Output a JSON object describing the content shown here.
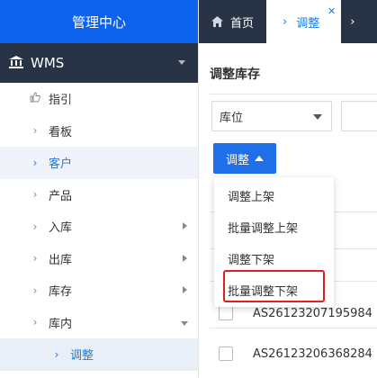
{
  "sidebar": {
    "brand": "管理中心",
    "module": "WMS",
    "items": [
      {
        "label": "指引"
      },
      {
        "label": "看板"
      },
      {
        "label": "客户"
      },
      {
        "label": "产品"
      },
      {
        "label": "入库"
      },
      {
        "label": "出库"
      },
      {
        "label": "库存"
      },
      {
        "label": "库内"
      },
      {
        "label": "调整"
      }
    ],
    "active_item": "客户",
    "active_sub_item": "调整"
  },
  "tabs": [
    {
      "label": "首页",
      "icon": "home-icon"
    },
    {
      "label": "调整",
      "active": true
    }
  ],
  "main": {
    "title": "调整库存",
    "location_select": "库位",
    "adjust_button": "调整",
    "dropdown": [
      "调整上架",
      "批量调整上架",
      "调整下架",
      "批量调整下架"
    ],
    "highlighted_option": "批量调整下架",
    "rows": [
      "AS26123207195984",
      "AS26123206368284"
    ]
  },
  "colors": {
    "brand": "#0e63ee",
    "dark_nav": "#283446",
    "accent": "#1e7be0",
    "highlight_border": "#e02020"
  }
}
